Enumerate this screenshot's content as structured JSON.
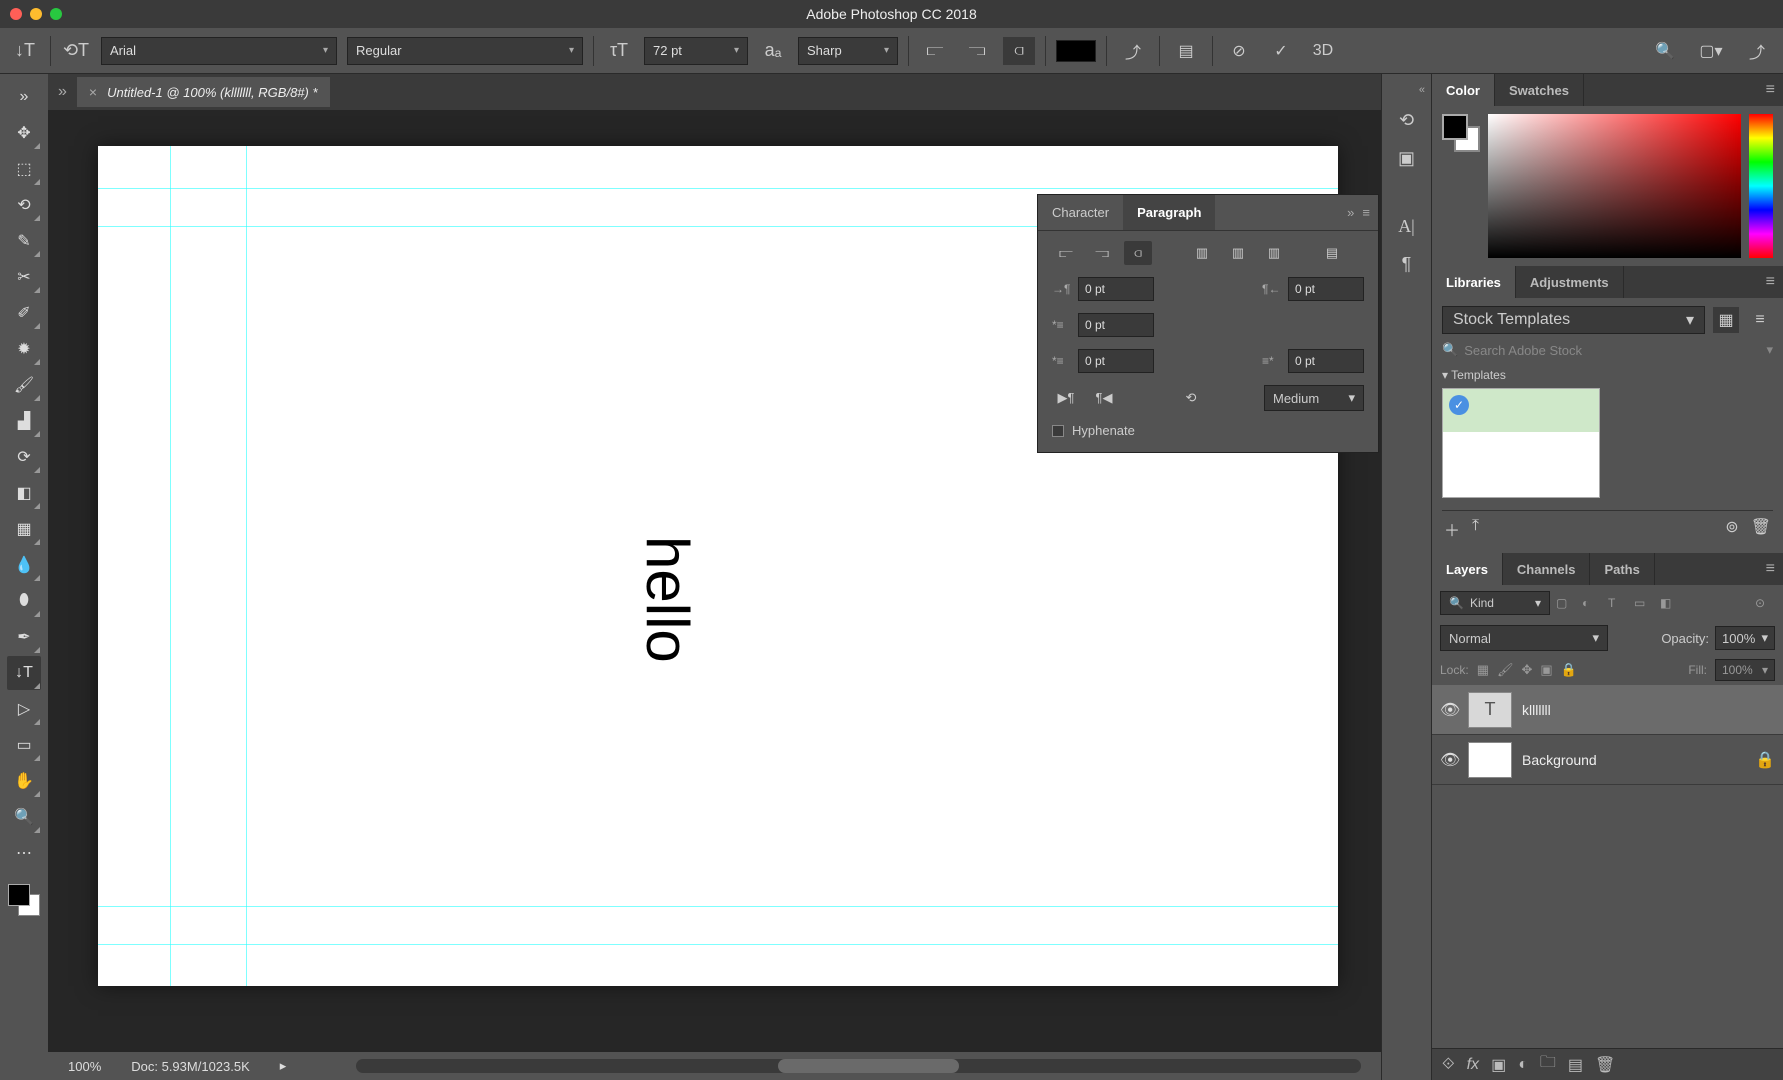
{
  "window": {
    "title": "Adobe Photoshop CC 2018"
  },
  "options": {
    "font_family": "Arial",
    "font_style": "Regular",
    "font_size": "72 pt",
    "aa": "Sharp",
    "color": "#000000",
    "threeD": "3D"
  },
  "document": {
    "tab_label": "Untitled-1 @ 100% (klllllll, RGB/8#) *",
    "canvas_text": "hello",
    "zoom": "100%",
    "doc_size": "Doc: 5.93M/1023.5K"
  },
  "paragraph_panel": {
    "tabs": {
      "character": "Character",
      "paragraph": "Paragraph"
    },
    "indent_left": "0 pt",
    "indent_right": "0 pt",
    "indent_first": "0 pt",
    "space_before": "0 pt",
    "space_after": "0 pt",
    "kinsoku": "Medium",
    "hyphenate": "Hyphenate"
  },
  "right": {
    "color": {
      "tab_color": "Color",
      "tab_swatches": "Swatches"
    },
    "libraries": {
      "tab_libraries": "Libraries",
      "tab_adjustments": "Adjustments",
      "dropdown": "Stock Templates",
      "search_placeholder": "Search Adobe Stock",
      "templates_header": "Templates"
    },
    "layers": {
      "tab_layers": "Layers",
      "tab_channels": "Channels",
      "tab_paths": "Paths",
      "kind": "Kind",
      "blend_mode": "Normal",
      "opacity_label": "Opacity:",
      "opacity_value": "100%",
      "lock_label": "Lock:",
      "fill_label": "Fill:",
      "fill_value": "100%",
      "items": [
        {
          "name": "klllllll",
          "type": "text",
          "locked": false,
          "active": true
        },
        {
          "name": "Background",
          "type": "raster",
          "locked": true,
          "active": false
        }
      ]
    }
  }
}
